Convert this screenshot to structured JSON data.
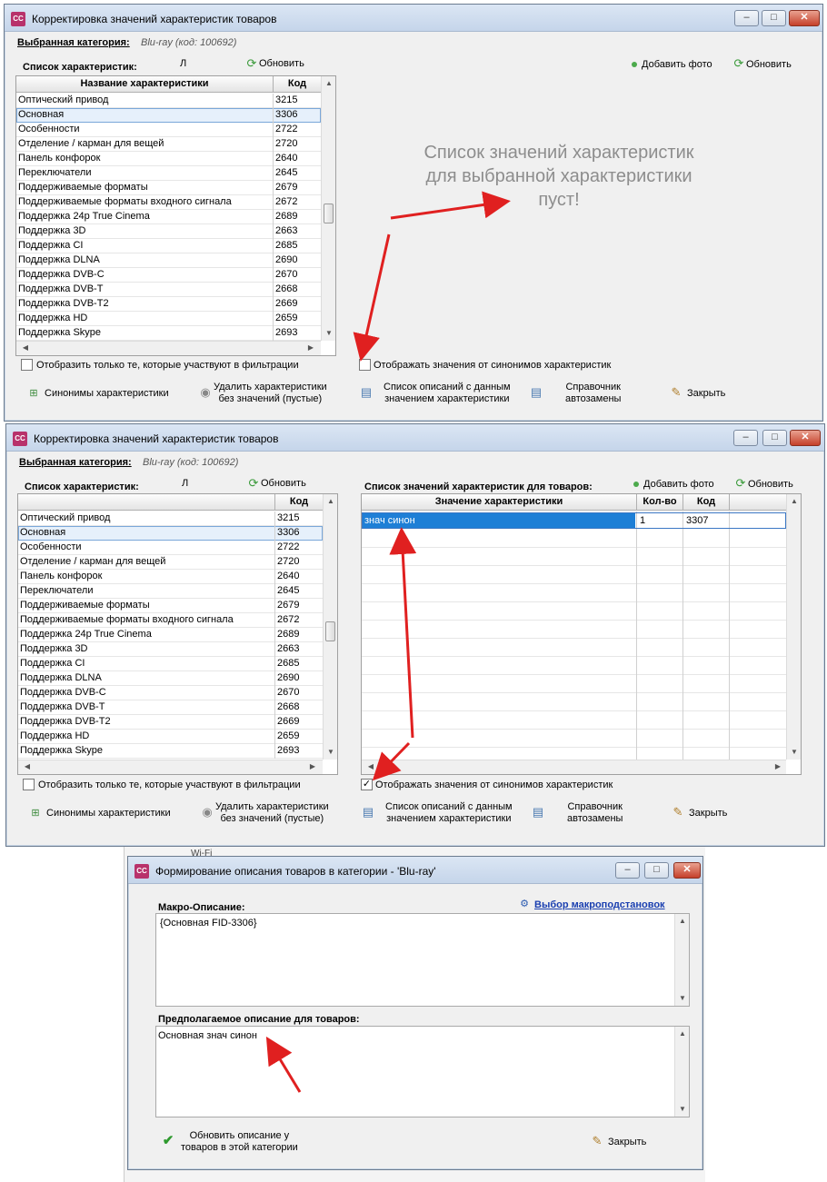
{
  "window1": {
    "title": "Корректировка значений характеристик товаров",
    "category_label": "Выбранная категория:",
    "category_value": "Blu-ray (код: 100692)",
    "list_label": "Список характеристик:",
    "stray_char": "Л",
    "refresh1": "Обновить",
    "add_photo": "Добавить фото",
    "refresh2": "Обновить",
    "col_name": "Название характеристики",
    "col_code": "Код",
    "rows": [
      {
        "name": "Оптический привод",
        "code": "3215"
      },
      {
        "name": "Основная",
        "code": "3306"
      },
      {
        "name": "Особенности",
        "code": "2722"
      },
      {
        "name": "Отделение / карман для вещей",
        "code": "2720"
      },
      {
        "name": "Панель конфорок",
        "code": "2640"
      },
      {
        "name": "Переключатели",
        "code": "2645"
      },
      {
        "name": "Поддерживаемые форматы",
        "code": "2679"
      },
      {
        "name": "Поддерживаемые форматы входного сигнала",
        "code": "2672"
      },
      {
        "name": "Поддержка 24p True Cinema",
        "code": "2689"
      },
      {
        "name": "Поддержка 3D",
        "code": "2663"
      },
      {
        "name": "Поддержка CI",
        "code": "2685"
      },
      {
        "name": "Поддержка DLNA",
        "code": "2690"
      },
      {
        "name": "Поддержка DVB-C",
        "code": "2670"
      },
      {
        "name": "Поддержка DVB-T",
        "code": "2668"
      },
      {
        "name": "Поддержка DVB-T2",
        "code": "2669"
      },
      {
        "name": "Поддержка HD",
        "code": "2659"
      },
      {
        "name": "Поддержка Skype",
        "code": "2693"
      }
    ],
    "empty_line1": "Список значений характеристик",
    "empty_line2": "для выбранной характеристики",
    "empty_line3": "пуст!",
    "filter_check": "Отобразить только те, которые участвуют в фильтрации",
    "synonym_check": "Отображать значения от синонимов характеристик",
    "btn_synonyms": "Синонимы характеристики",
    "btn_delete_l1": "Удалить характеристики",
    "btn_delete_l2": "без значений (пустые)",
    "btn_desc_l1": "Список описаний с данным",
    "btn_desc_l2": "значением характеристики",
    "btn_ref_l1": "Справочник",
    "btn_ref_l2": "автозамены",
    "btn_close": "Закрыть"
  },
  "window2": {
    "title": "Корректировка значений характеристик товаров",
    "category_label": "Выбранная категория:",
    "category_value": "Blu-ray (код: 100692)",
    "list_label": "Список характеристик:",
    "stray_char": "Л",
    "refresh1": "Обновить",
    "values_label": "Список значений характеристик для товаров:",
    "add_photo": "Добавить фото",
    "refresh2": "Обновить",
    "col_value": "Значение характеристики",
    "col_qty": "Кол-во",
    "col_code": "Код",
    "value_row": {
      "value": "знач синон",
      "qty": "1",
      "code": "3307"
    },
    "filter_check": "Отобразить только те, которые участвуют в фильтрации",
    "synonym_check": "Отображать значения от синонимов характеристик",
    "synonym_checked": true,
    "btn_synonyms": "Синонимы характеристики",
    "btn_delete_l1": "Удалить характеристики",
    "btn_delete_l2": "без значений (пустые)",
    "btn_desc_l1": "Список описаний с данным",
    "btn_desc_l2": "значением характеристики",
    "btn_ref_l1": "Справочник",
    "btn_ref_l2": "автозамены",
    "btn_close": "Закрыть"
  },
  "window3": {
    "title": "Формирование описания товаров в категории - 'Blu-ray'",
    "macro_label": "Макро-Описание:",
    "macro_link": "Выбор макроподстановок",
    "macro_text": "{Основная FID-3306}",
    "expected_label": "Предполагаемое описание для товаров:",
    "expected_text": "Основная знач синон",
    "btn_update_l1": "Обновить описание у",
    "btn_update_l2": "товаров в этой категории",
    "btn_close": "Закрыть"
  },
  "background": {
    "wifi_text": "Wi-Fi"
  },
  "colors": {
    "selection_blue": "#1e7fd6",
    "annotation_red": "#e02020",
    "link_blue": "#1a3fb0"
  }
}
